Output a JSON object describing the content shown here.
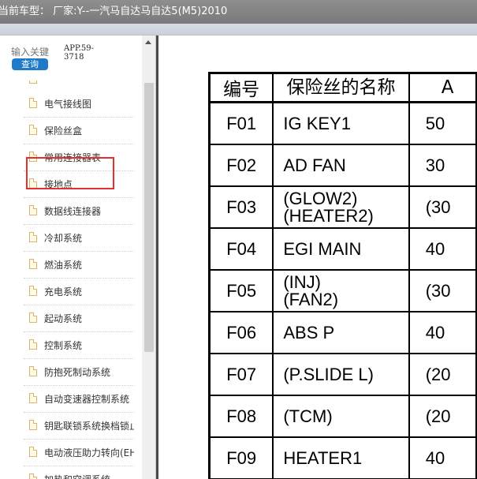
{
  "header": {
    "title": "当前车型：  厂家:Y--一汽马自达马自达5(M5)2010"
  },
  "search": {
    "placeholder": "输入关键",
    "button_label": "查询",
    "app_code": "APP.59-3718"
  },
  "tree": {
    "items": [
      {
        "label": "电气接线图"
      },
      {
        "label": "保险丝盒"
      },
      {
        "label": "常用连接器表"
      },
      {
        "label": "接地点"
      },
      {
        "label": "数据线连接器"
      },
      {
        "label": "冷却系统"
      },
      {
        "label": "燃油系统"
      },
      {
        "label": "充电系统"
      },
      {
        "label": "起动系统"
      },
      {
        "label": "控制系统"
      },
      {
        "label": "防抱死制动系统"
      },
      {
        "label": "自动变速器控制系统"
      },
      {
        "label": "钥匙联锁系统换档锁止"
      },
      {
        "label": "电动液压助力转向(EH"
      },
      {
        "label": "加热和空调系统"
      }
    ],
    "selected_index": 1
  },
  "fuse_table": {
    "headers": [
      "编号",
      "保险丝的名称",
      "A"
    ],
    "rows": [
      {
        "code": "F01",
        "name": "IG KEY1",
        "amp": "50"
      },
      {
        "code": "F02",
        "name": "AD FAN",
        "amp": "30"
      },
      {
        "code": "F03",
        "name": "(GLOW2)\n(HEATER2)",
        "amp": "(30"
      },
      {
        "code": "F04",
        "name": "EGI MAIN",
        "amp": "40"
      },
      {
        "code": "F05",
        "name": "(INJ)\n(FAN2)",
        "amp": "(30"
      },
      {
        "code": "F06",
        "name": "ABS P",
        "amp": "40"
      },
      {
        "code": "F07",
        "name": "(P.SLIDE L)",
        "amp": "(20"
      },
      {
        "code": "F08",
        "name": "(TCM)",
        "amp": "(20"
      },
      {
        "code": "F09",
        "name": "HEATER1",
        "amp": "40"
      }
    ]
  },
  "colors": {
    "titlebar": "#7f7f7f",
    "button": "#1f7bc8",
    "highlight": "#e03030"
  },
  "icons": {
    "tree_item": "document-icon",
    "scroll": "arrow-up-icon"
  }
}
